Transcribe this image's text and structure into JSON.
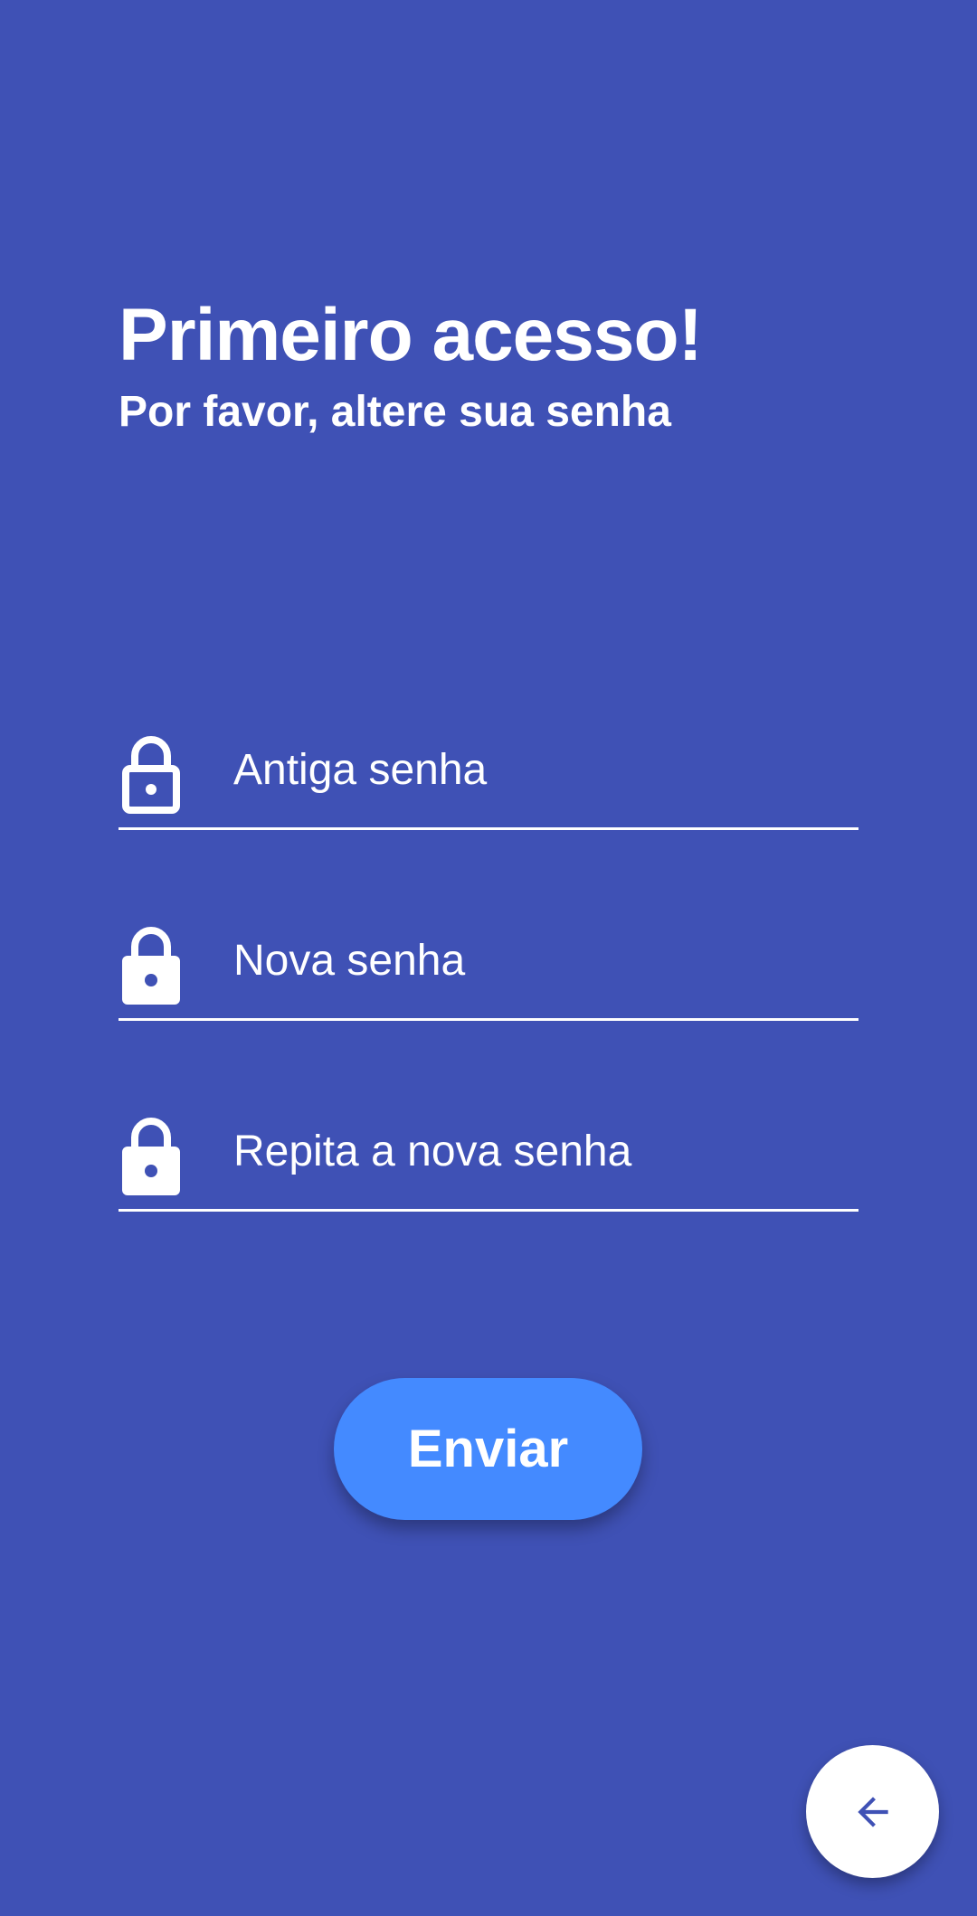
{
  "header": {
    "title": "Primeiro acesso!",
    "subtitle": "Por favor, altere sua senha"
  },
  "form": {
    "fields": [
      {
        "placeholder": "Antiga senha",
        "value": "",
        "icon": "lock-outline-icon"
      },
      {
        "placeholder": "Nova senha",
        "value": "",
        "icon": "lock-icon"
      },
      {
        "placeholder": "Repita a nova senha",
        "value": "",
        "icon": "lock-icon"
      }
    ],
    "submit_label": "Enviar"
  },
  "fab": {
    "icon": "arrow-back-icon"
  },
  "colors": {
    "background": "#3f51b5",
    "button": "#448aff",
    "text": "#ffffff",
    "fab_background": "#ffffff",
    "fab_icon": "#3f51b5"
  }
}
